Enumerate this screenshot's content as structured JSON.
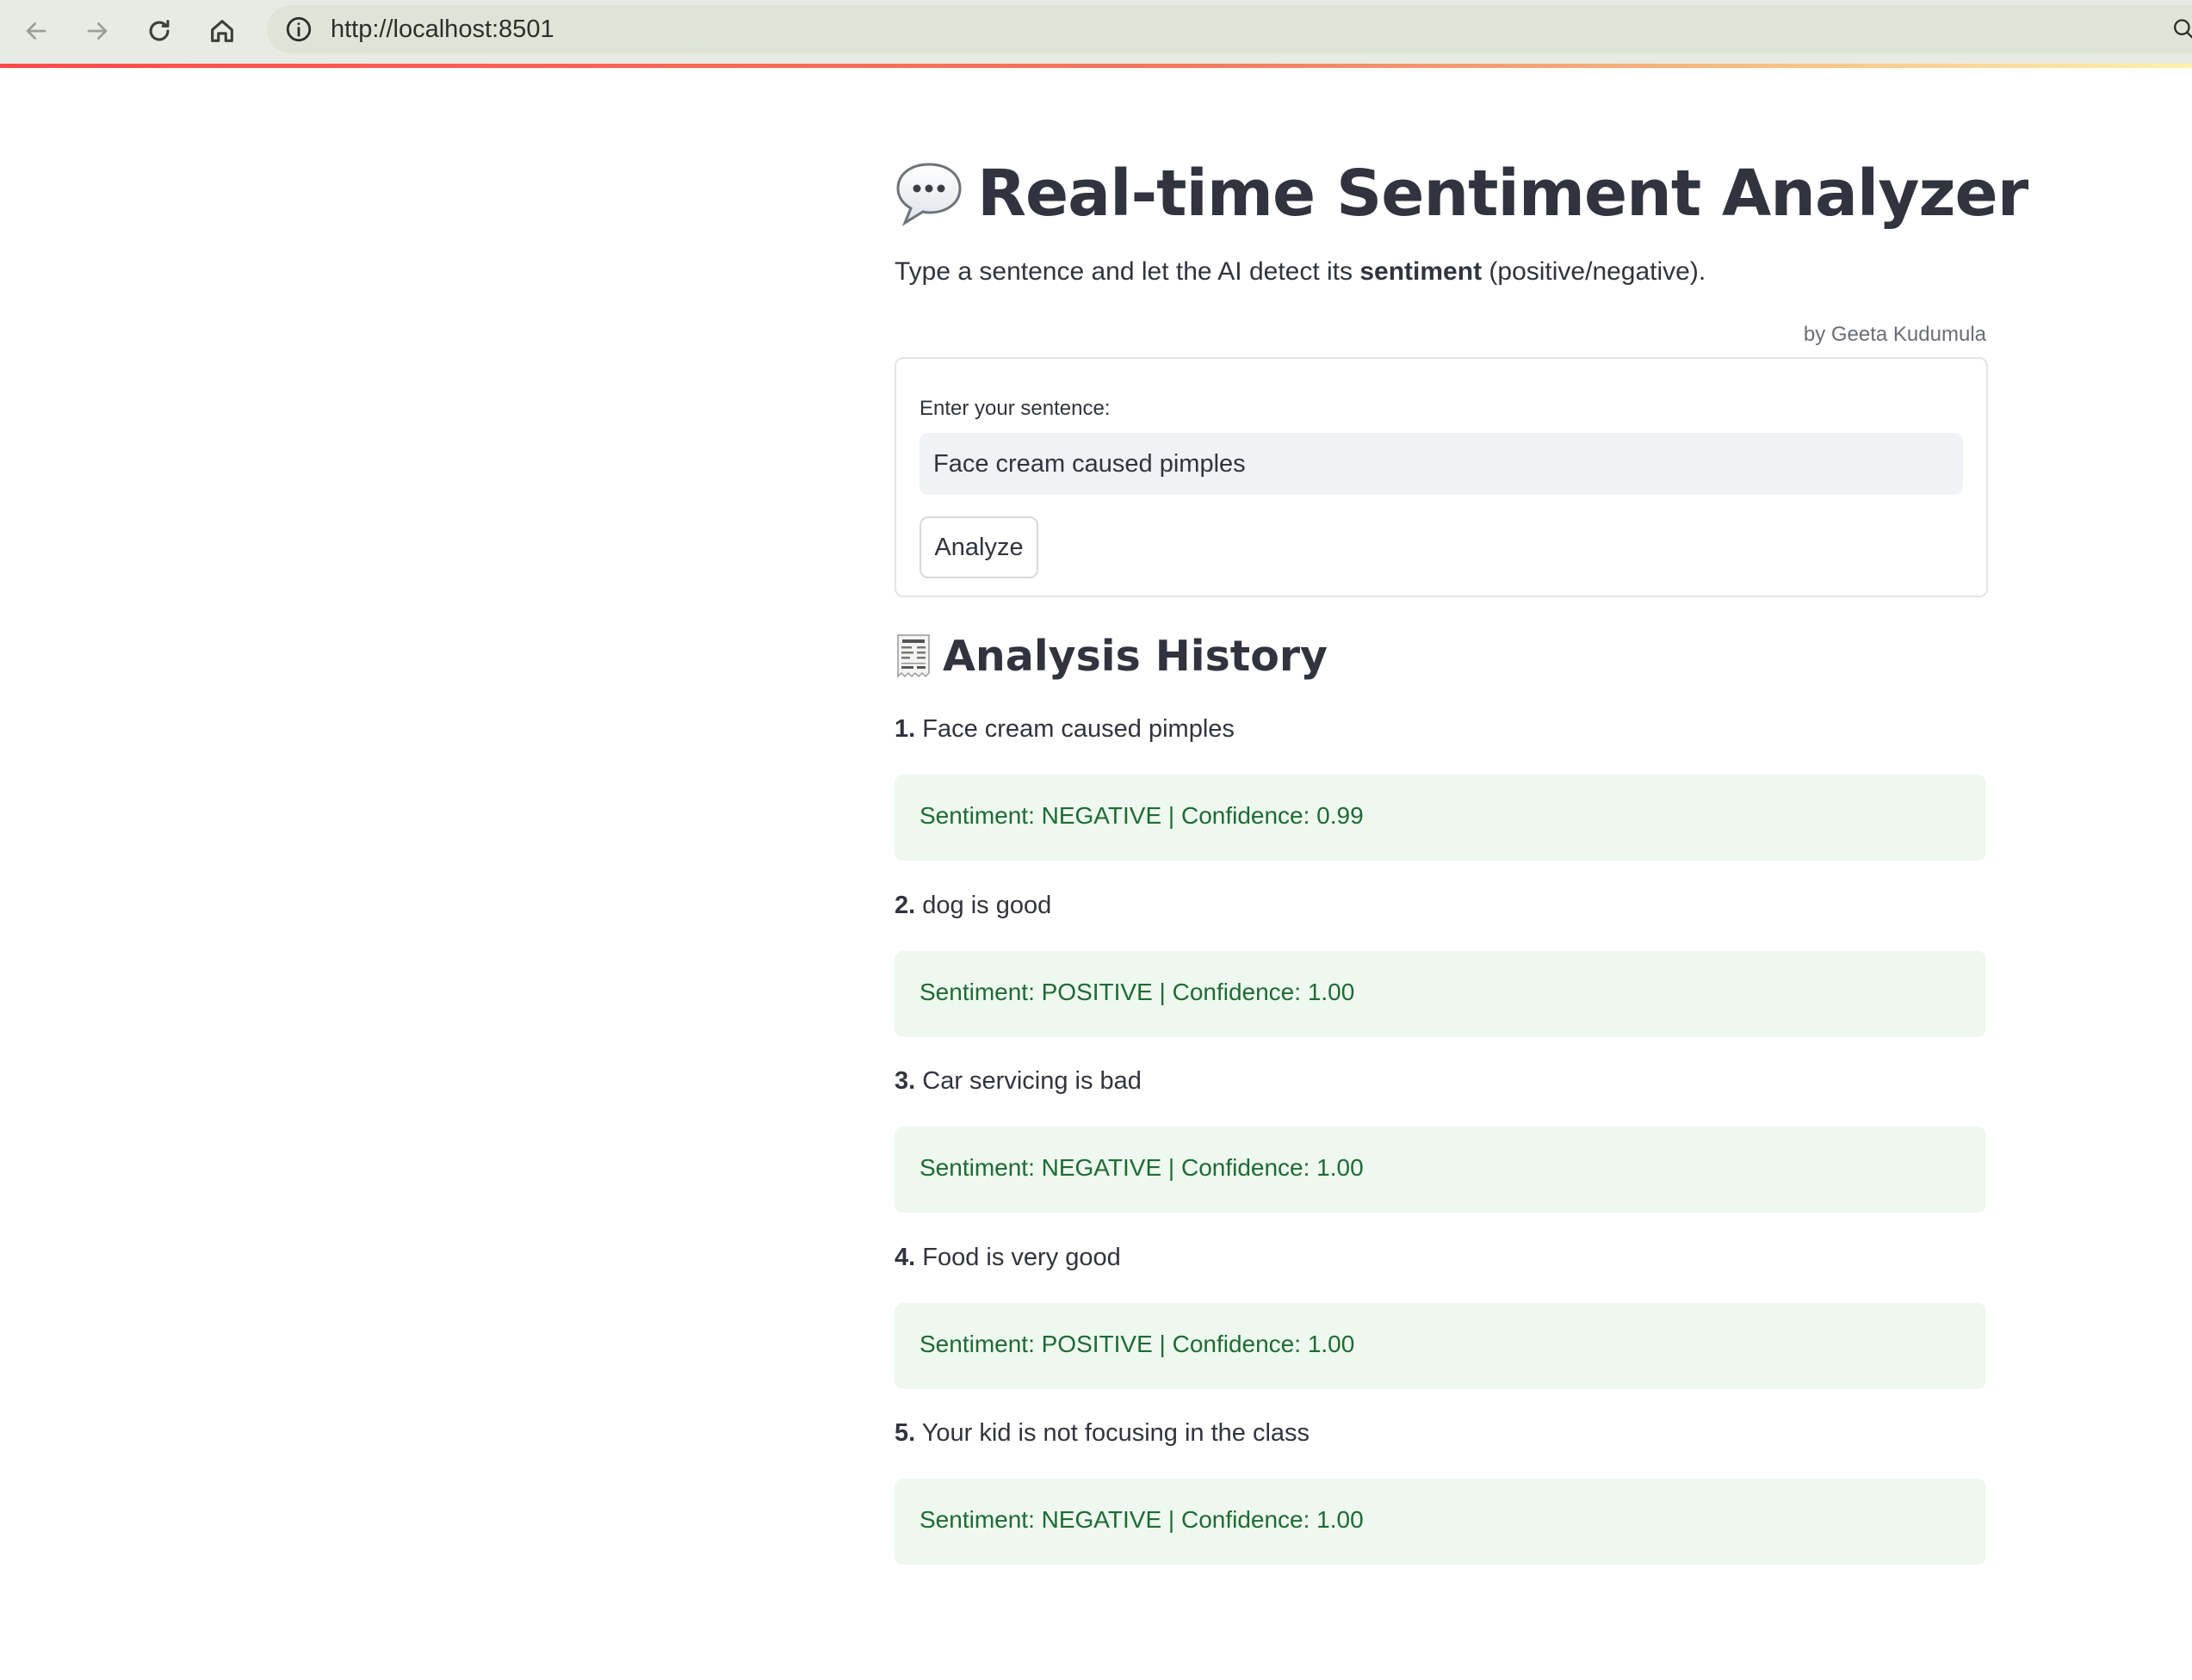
{
  "browser": {
    "url": "http://localhost:8501",
    "nav_icons": [
      "back-arrow-icon",
      "forward-arrow-icon",
      "reload-icon",
      "home-icon",
      "site-info-icon",
      "zoom-icon"
    ]
  },
  "app": {
    "title_icon": "speech-bubble-icon",
    "title": "Real-time Sentiment Analyzer",
    "subtitle_before": "Type a sentence and let the AI detect its ",
    "subtitle_bold": "sentiment",
    "subtitle_after": " (positive/negative).",
    "byline": "by Geeta Kudumula"
  },
  "form": {
    "label": "Enter your sentence:",
    "input_value": "Face cream caused pimples",
    "button_label": "Analyze"
  },
  "history": {
    "icon": "receipt-icon",
    "title": "Analysis History",
    "entries": [
      {
        "num": "1.",
        "text": "Face cream caused pimples",
        "result": "Sentiment: NEGATIVE | Confidence: 0.99"
      },
      {
        "num": "2.",
        "text": "dog is good",
        "result": "Sentiment: POSITIVE | Confidence: 1.00"
      },
      {
        "num": "3.",
        "text": "Car servicing is bad",
        "result": "Sentiment: NEGATIVE | Confidence: 1.00"
      },
      {
        "num": "4.",
        "text": "Food is very good",
        "result": "Sentiment: POSITIVE | Confidence: 1.00"
      },
      {
        "num": "5.",
        "text": "Your kid is not focusing in the class",
        "result": "Sentiment: NEGATIVE | Confidence: 1.00"
      }
    ]
  },
  "colors": {
    "accent_gradient_start": "#ff4b4b",
    "result_background": "#eef8ef",
    "result_text": "#1e6b33"
  }
}
